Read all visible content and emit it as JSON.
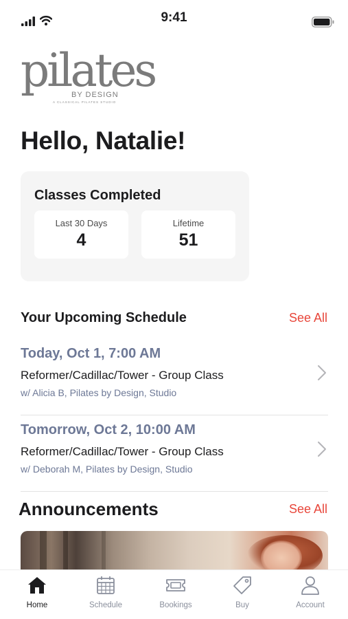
{
  "status_bar": {
    "time": "9:41"
  },
  "brand": {
    "logo_word": "pilates",
    "logo_sub": "BY DESIGN",
    "logo_tagline": "A CLASSICAL PILATES STUDIO"
  },
  "greeting": "Hello, Natalie!",
  "classes_completed": {
    "title": "Classes Completed",
    "stats": [
      {
        "label": "Last 30 Days",
        "value": "4"
      },
      {
        "label": "Lifetime",
        "value": "51"
      }
    ]
  },
  "schedule": {
    "title": "Your Upcoming Schedule",
    "see_all": "See All",
    "items": [
      {
        "date": "Today, Oct 1, 7:00 AM",
        "class": "Reformer/Cadillac/Tower - Group Class",
        "meta": "w/ Alicia B, Pilates by Design, Studio"
      },
      {
        "date": "Tomorrow, Oct 2, 10:00 AM",
        "class": "Reformer/Cadillac/Tower - Group Class",
        "meta": "w/ Deborah M, Pilates by Design, Studio"
      }
    ]
  },
  "announcements": {
    "title": "Announcements",
    "see_all": "See All"
  },
  "tabs": [
    {
      "label": "Home",
      "icon": "home-icon",
      "active": true
    },
    {
      "label": "Schedule",
      "icon": "calendar-icon",
      "active": false
    },
    {
      "label": "Bookings",
      "icon": "ticket-icon",
      "active": false
    },
    {
      "label": "Buy",
      "icon": "tag-icon",
      "active": false
    },
    {
      "label": "Account",
      "icon": "person-icon",
      "active": false
    }
  ],
  "colors": {
    "accent": "#e8463a",
    "slate": "#6d7896",
    "text": "#1c1c1e",
    "card": "#f5f5f5",
    "tab_inactive": "#8a8f9c"
  }
}
